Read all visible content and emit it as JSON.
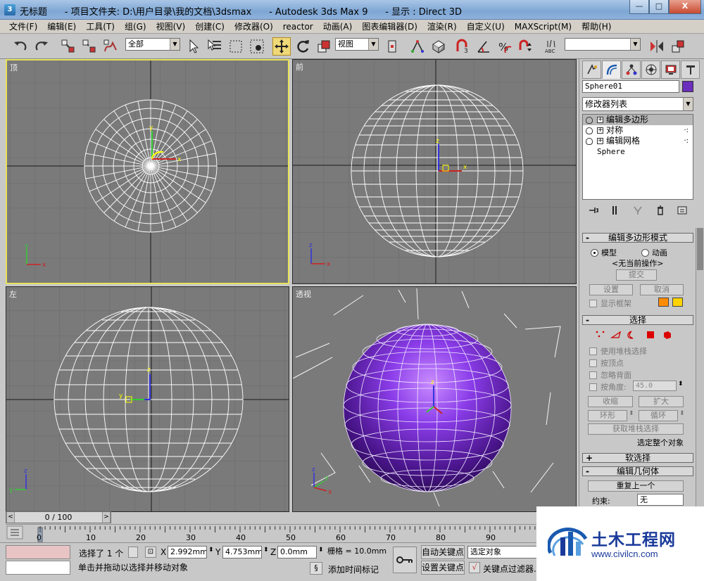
{
  "window": {
    "title": "无标题      - 项目文件夹: D:\\用户目录\\我的文档\\3dsmax      - Autodesk 3ds Max 9      - 显示 : Direct 3D",
    "buttons": {
      "minimize": "—",
      "maximize": "□",
      "close": "X"
    }
  },
  "menubar": {
    "items": [
      "文件(F)",
      "编辑(E)",
      "工具(T)",
      "组(G)",
      "视图(V)",
      "创建(C)",
      "修改器(O)",
      "reactor",
      "动画(A)",
      "图表编辑器(D)",
      "渲染(R)",
      "自定义(U)",
      "MAXScript(M)",
      "帮助(H)"
    ]
  },
  "toolbar": {
    "selection_filter": "全部",
    "ref_coord": "视图",
    "named_selection": ""
  },
  "viewports": {
    "top": {
      "label": "顶"
    },
    "front": {
      "label": "前"
    },
    "left": {
      "label": "左"
    },
    "perspective": {
      "label": "透视"
    }
  },
  "colors": {
    "viewport_bg": "#7a7a7a",
    "active_border": "#e8e25a",
    "object_color": "#6b2dbb",
    "wire": "#ffffff"
  },
  "command_panel": {
    "object_name": "Sphere01",
    "modifier_list": "修改器列表",
    "stack": [
      {
        "label": "编辑多边形",
        "selected": true
      },
      {
        "label": "对称",
        "selected": false
      },
      {
        "label": "编辑网格",
        "selected": false
      }
    ],
    "stack_base": "Sphere",
    "rollouts": {
      "edit_poly_mode": {
        "title": "编辑多边形模式",
        "radio_model": "模型",
        "radio_anim": "动画",
        "no_current_op": "<无当前操作>",
        "commit": "提交",
        "settings": "设置",
        "cancel": "取消",
        "show_cage": "显示框架"
      },
      "selection": {
        "title": "选择",
        "use_stack": "使用堆栈选择",
        "by_vertex": "按顶点",
        "ignore_backfacing": "忽略背面",
        "by_angle": "按角度:",
        "angle_value": "45.0",
        "shrink": "收缩",
        "grow": "扩大",
        "ring": "环形",
        "loop": "循环",
        "get_stack_sel": "获取堆栈选择",
        "whole_object": "选定整个对象"
      },
      "soft_selection": {
        "title": "软选择"
      },
      "edit_geometry": {
        "title": "编辑几何体",
        "repeat_last": "重复上一个",
        "constraints_label": "约束:",
        "constraints_value": "无"
      }
    }
  },
  "timeline": {
    "frame_display": "0 / 100",
    "ticks": [
      "0",
      "10",
      "20",
      "30",
      "40",
      "50",
      "60",
      "70",
      "80",
      "90"
    ]
  },
  "status": {
    "selected": "选择了 1 个",
    "x_label": "X",
    "x_value": "2.992mm",
    "y_label": "Y",
    "y_value": "4.753mm",
    "z_label": "Z",
    "z_value": "0.0mm",
    "grid": "栅格 = 10.0mm",
    "auto_key": "自动关键点",
    "selected_obj": "选定对象",
    "set_key": "设置关键点",
    "key_filters": "关键点过滤器...",
    "prompt": "单击并拖动以选择并移动对象",
    "add_time_tag": "添加时间标记"
  },
  "watermark": {
    "title": "土木工程网",
    "url": "www.civilcn.com"
  }
}
